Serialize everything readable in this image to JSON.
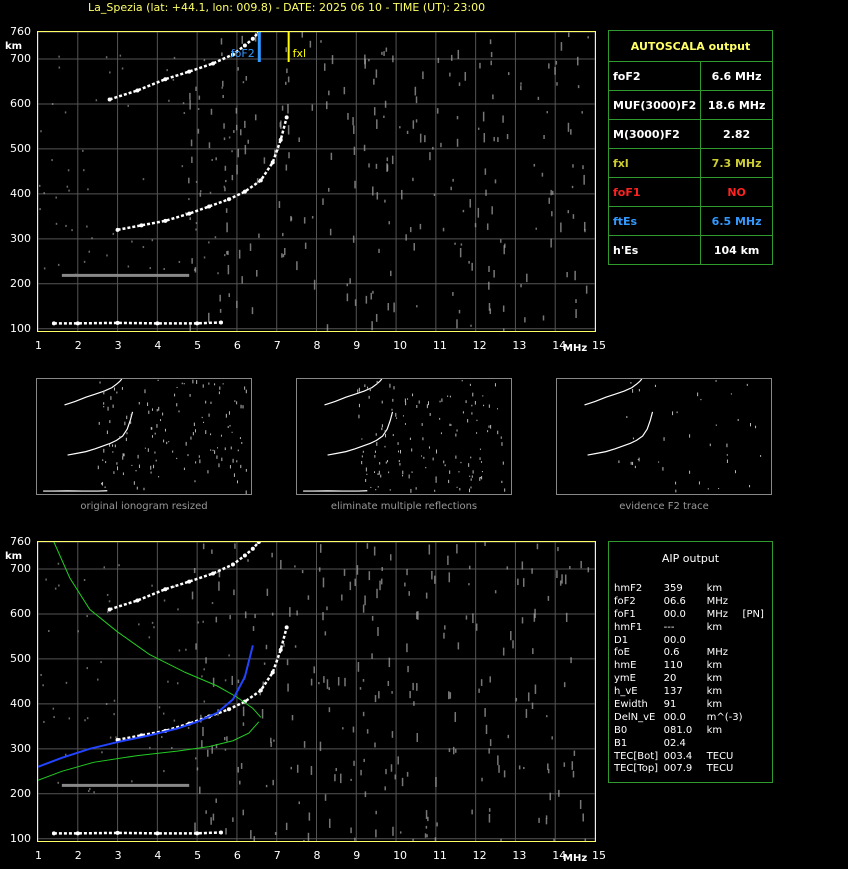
{
  "header": {
    "title": "La_Spezia (lat: +44.1, lon: 009.8) - DATE: 2025 06 10 - TIME (UT): 23:00"
  },
  "axes": {
    "y_unit": "km",
    "x_unit": "MHz",
    "y_ticks": [
      "760",
      "700",
      "600",
      "500",
      "400",
      "300",
      "200",
      "100"
    ],
    "x_ticks": [
      "1",
      "2",
      "3",
      "4",
      "5",
      "6",
      "7",
      "8",
      "9",
      "10",
      "11",
      "12",
      "13",
      "14",
      "15"
    ]
  },
  "markers": {
    "fof2_label": "foF2",
    "fxl_label": "fxl",
    "fof2_color": "#3399ff",
    "fxl_color": "#ffff00"
  },
  "autoscala": {
    "title": "AUTOSCALA output",
    "rows": [
      {
        "name": "foF2",
        "value": "6.6 MHz",
        "color": "#ffffff"
      },
      {
        "name": "MUF(3000)F2",
        "value": "18.6 MHz",
        "color": "#ffffff"
      },
      {
        "name": "M(3000)F2",
        "value": "2.82",
        "color": "#ffffff"
      },
      {
        "name": "fxl",
        "value": "7.3 MHz",
        "color": "#cccc33"
      },
      {
        "name": "foF1",
        "value": "NO",
        "color": "#ff2222"
      },
      {
        "name": "ftEs",
        "value": "6.5 MHz",
        "color": "#3399ff"
      },
      {
        "name": "h'Es",
        "value": "104     km",
        "color": "#ffffff"
      }
    ]
  },
  "thumbnails": {
    "captions": [
      "original ionogram resized",
      "eliminate multiple reflections",
      "evidence F2 trace"
    ]
  },
  "aip": {
    "title": "AIP output",
    "rows": [
      [
        "hmF2",
        "359",
        "km",
        ""
      ],
      [
        "foF2",
        "06.6",
        "MHz",
        ""
      ],
      [
        "foF1",
        "00.0",
        "MHz",
        "[PN]"
      ],
      [
        "hmF1",
        "---",
        "km",
        ""
      ],
      [
        "D1",
        "00.0",
        "",
        ""
      ],
      [
        "foE",
        "0.6",
        "MHz",
        ""
      ],
      [
        "hmE",
        "110",
        "km",
        ""
      ],
      [
        "ymE",
        "20",
        "km",
        ""
      ],
      [
        "h_vE",
        "137",
        "km",
        ""
      ],
      [
        "Ewidth",
        "91",
        "km",
        ""
      ],
      [
        "DelN_vE",
        "00.0",
        "m^(-3)",
        ""
      ],
      [
        "B0",
        "081.0",
        "km",
        ""
      ],
      [
        "B1",
        "02.4",
        "",
        ""
      ],
      [
        "TEC[Bot]",
        "003.4",
        "TECU",
        ""
      ],
      [
        "TEC[Top]",
        "007.9",
        "TECU",
        ""
      ]
    ]
  },
  "chart_data": [
    {
      "type": "scatter",
      "xlabel": "MHz",
      "ylabel": "km",
      "xlim": [
        1,
        15
      ],
      "ylim": [
        95,
        760
      ],
      "series": [
        {
          "name": "F2 trace (o)",
          "color": "#ffffff",
          "x": [
            2.8,
            3.5,
            4.2,
            4.8,
            5.4,
            5.9,
            6.2,
            6.4,
            6.55
          ],
          "y": [
            610,
            630,
            655,
            672,
            690,
            710,
            730,
            745,
            760
          ]
        },
        {
          "name": "F2 trace (low)",
          "color": "#ffffff",
          "x": [
            3.0,
            3.6,
            4.2,
            4.8,
            5.3,
            5.8,
            6.2,
            6.6,
            6.9,
            7.1,
            7.25
          ],
          "y": [
            320,
            330,
            340,
            356,
            372,
            388,
            405,
            430,
            470,
            520,
            570
          ]
        },
        {
          "name": "E trace",
          "color": "#ffffff",
          "x": [
            1.4,
            2.0,
            3.0,
            4.0,
            5.0,
            5.6
          ],
          "y": [
            112,
            112,
            113,
            112,
            112,
            114
          ]
        }
      ],
      "markers": {
        "foF2": 6.6,
        "fxl": 7.3
      }
    },
    {
      "type": "line",
      "xlabel": "MHz",
      "ylabel": "km",
      "xlim": [
        1,
        15
      ],
      "ylim": [
        95,
        760
      ],
      "series": [
        {
          "name": "profile upper",
          "color": "#22cc22",
          "x": [
            1.4,
            1.8,
            2.3,
            3.0,
            3.8,
            4.7,
            5.5,
            6.0,
            6.4,
            6.6
          ],
          "y": [
            760,
            680,
            610,
            560,
            510,
            470,
            440,
            415,
            390,
            370
          ]
        },
        {
          "name": "profile lower",
          "color": "#22cc22",
          "x": [
            1.0,
            1.6,
            2.4,
            3.5,
            4.5,
            5.3,
            5.9,
            6.3,
            6.55
          ],
          "y": [
            230,
            250,
            270,
            285,
            295,
            305,
            318,
            335,
            360
          ]
        },
        {
          "name": "true height",
          "color": "#2244ff",
          "x": [
            1.0,
            1.6,
            2.3,
            3.0,
            3.8,
            4.5,
            5.0,
            5.5,
            5.9,
            6.2,
            6.4
          ],
          "y": [
            260,
            280,
            300,
            315,
            330,
            345,
            360,
            380,
            410,
            460,
            530
          ]
        }
      ]
    }
  ]
}
